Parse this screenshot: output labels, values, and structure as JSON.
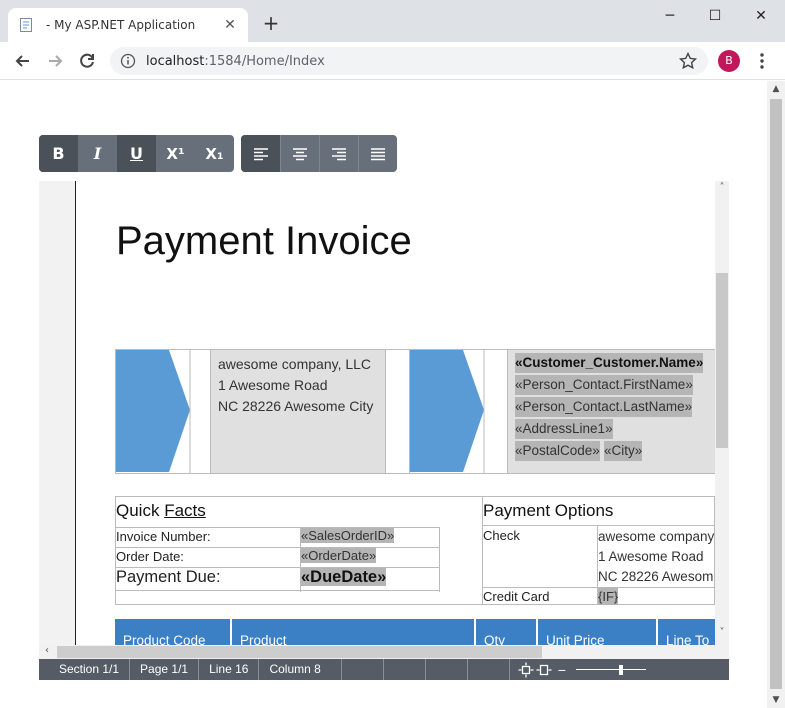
{
  "browser": {
    "tab_title": "- My ASP.NET Application",
    "url_host": "localhost",
    "url_path": ":1584/Home/Index",
    "profile_initial": "B"
  },
  "toolbar": {
    "bold": "B",
    "italic": "I",
    "underline": "U",
    "superscript": "X¹",
    "subscript": "X₁"
  },
  "document": {
    "title": "Payment Invoice",
    "company_address": [
      "awesome company, LLC",
      "1 Awesome Road",
      "NC 28226 Awesome City"
    ],
    "customer_fields": {
      "name": "«Customer_Customer.Name»",
      "first_name": "«Person_Contact.FirstName»",
      "last_name": "«Person_Contact.LastName»",
      "address": "«AddressLine1»",
      "postal_code": "«PostalCode»",
      "city": "«City»"
    },
    "quick_facts": {
      "title_a": "Quick ",
      "title_b": "Facts",
      "invoice_number_label": "Invoice Number:",
      "invoice_number_value": "«SalesOrderID»",
      "order_date_label": "Order Date:",
      "order_date_value": "«OrderDate»",
      "payment_due_label": "Payment Due:",
      "payment_due_value": "«DueDate»"
    },
    "payment_options": {
      "title": "Payment Options",
      "check_label": "Check",
      "check_lines": [
        "awesome company",
        "1 Awesome Road",
        "NC 28226 Awesom"
      ],
      "credit_card_label": "Credit Card",
      "credit_card_value": "{IF}"
    },
    "product_table": {
      "headers": [
        "Product Code",
        "Product",
        "Qty",
        "Unit Price",
        "Line To"
      ]
    }
  },
  "status_bar": {
    "section": "Section 1/1",
    "page": "Page 1/1",
    "line": "Line 16",
    "column": "Column 8"
  },
  "colors": {
    "toolbar": "#676f7a",
    "toolbar_active": "#4a5159",
    "header_blue": "#3b7fc4",
    "arrow_blue": "#5b9bd5",
    "merge_field_bg": "#b5b5b5",
    "status_bar": "#555c66"
  }
}
